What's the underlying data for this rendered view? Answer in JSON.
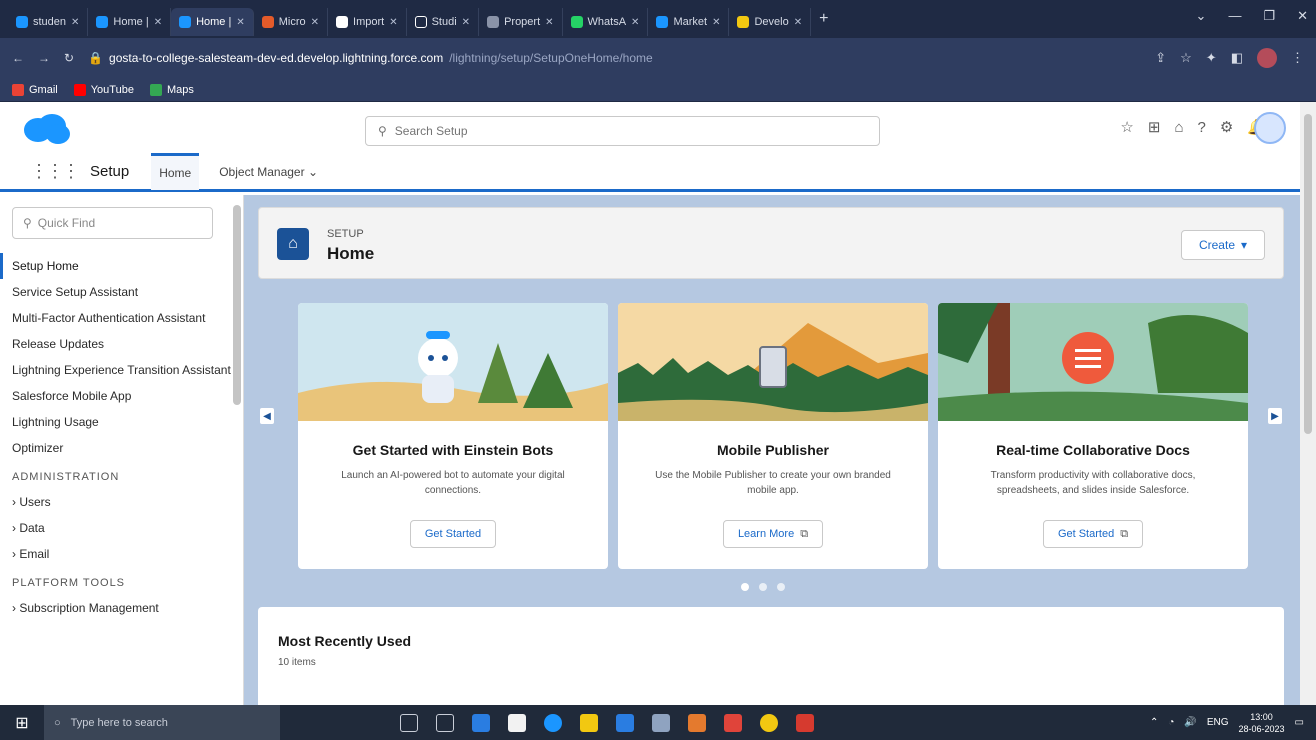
{
  "browser": {
    "tabs": [
      {
        "label": "studen",
        "active": false
      },
      {
        "label": "Home |",
        "active": false
      },
      {
        "label": "Home |",
        "active": true
      },
      {
        "label": "Micro",
        "active": false
      },
      {
        "label": "Import",
        "active": false
      },
      {
        "label": "Studi",
        "active": false
      },
      {
        "label": "Propert",
        "active": false
      },
      {
        "label": "WhatsA",
        "active": false
      },
      {
        "label": "Market",
        "active": false
      },
      {
        "label": "Develo",
        "active": false
      }
    ],
    "url_host": "gosta-to-college-salesteam-dev-ed.develop.lightning.force.com",
    "url_path": "/lightning/setup/SetupOneHome/home",
    "bookmarks": [
      "Gmail",
      "YouTube",
      "Maps"
    ]
  },
  "header": {
    "search_placeholder": "Search Setup",
    "app_name": "Setup",
    "tabs": [
      "Home",
      "Object Manager"
    ]
  },
  "sidebar": {
    "quickfind_placeholder": "Quick Find",
    "items": [
      "Setup Home",
      "Service Setup Assistant",
      "Multi-Factor Authentication Assistant",
      "Release Updates",
      "Lightning Experience Transition Assistant",
      "Salesforce Mobile App",
      "Lightning Usage",
      "Optimizer"
    ],
    "section_admin": "ADMINISTRATION",
    "admin_items": [
      "Users",
      "Data",
      "Email"
    ],
    "section_platform": "PLATFORM TOOLS",
    "platform_items": [
      "Subscription Management"
    ]
  },
  "main": {
    "pre_title": "SETUP",
    "title": "Home",
    "create_label": "Create",
    "cards": [
      {
        "title": "Get Started with Einstein Bots",
        "desc": "Launch an AI-powered bot to automate your digital connections.",
        "button": "Get Started"
      },
      {
        "title": "Mobile Publisher",
        "desc": "Use the Mobile Publisher to create your own branded mobile app.",
        "button": "Learn More"
      },
      {
        "title": "Real-time Collaborative Docs",
        "desc": "Transform productivity with collaborative docs, spreadsheets, and slides inside Salesforce.",
        "button": "Get Started"
      }
    ],
    "recent_title": "Most Recently Used",
    "recent_count": "10 items"
  },
  "taskbar": {
    "search_placeholder": "Type here to search",
    "lang": "ENG",
    "time": "13:00",
    "date": "28-06-2023"
  },
  "colors": {
    "brand": "#1b96ff",
    "accent": "#1b6ac9",
    "home_icon": "#1b5297"
  }
}
